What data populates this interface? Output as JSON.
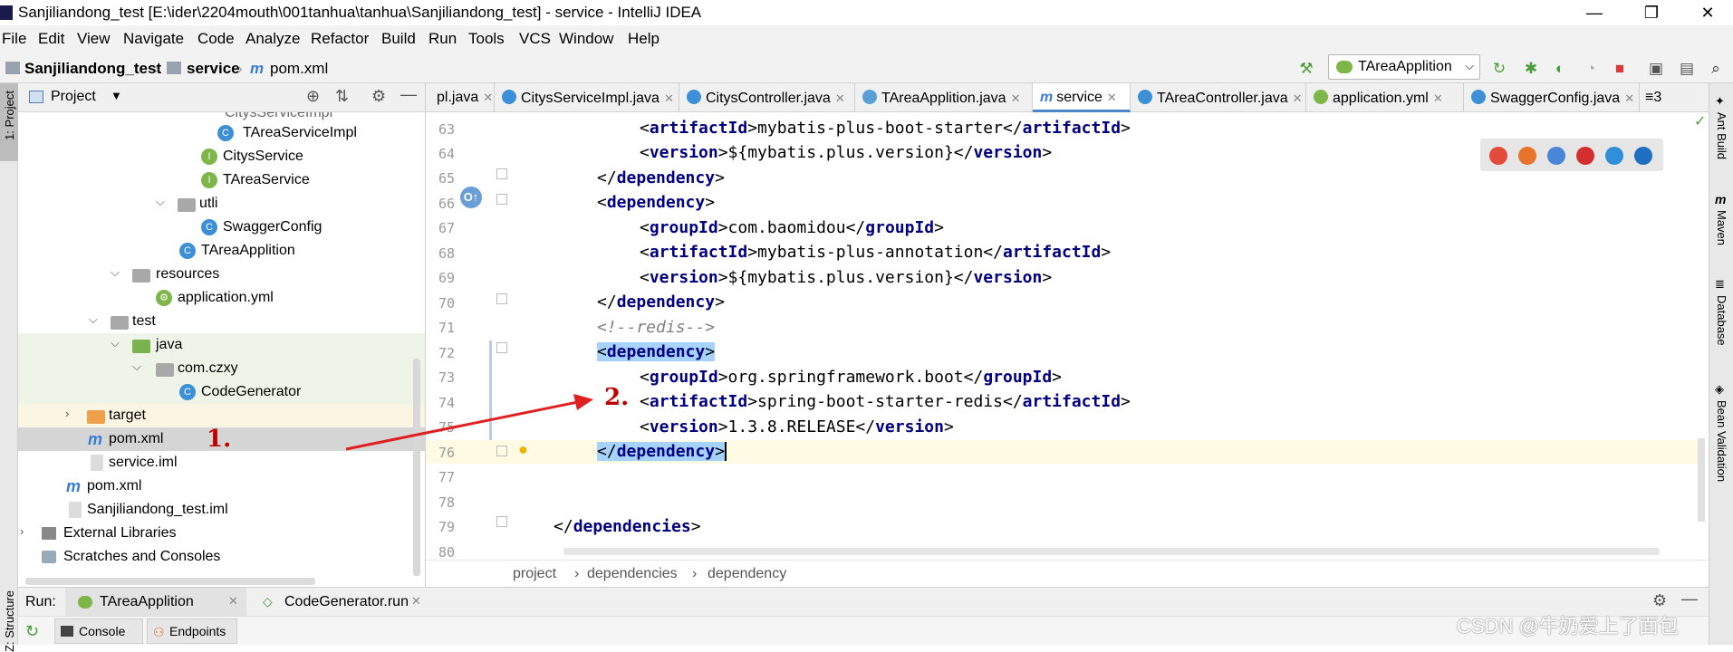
{
  "window": {
    "title": "Sanjiliandong_test [E:\\ider\\2204mouth\\001tanhua\\tanhua\\Sanjiliandong_test] - service - IntelliJ IDEA"
  },
  "menu": [
    "File",
    "Edit",
    "View",
    "Navigate",
    "Code",
    "Analyze",
    "Refactor",
    "Build",
    "Run",
    "Tools",
    "VCS",
    "Window",
    "Help"
  ],
  "breadcrumb_nav": [
    "Sanjiliandong_test",
    "service",
    "pom.xml"
  ],
  "run_config": {
    "label": "TAreaApplition"
  },
  "project_panel": {
    "header": "Project",
    "tree": [
      {
        "label": "TAreaServiceImpl",
        "icon": "class-icon"
      },
      {
        "label": "CitysService",
        "icon": "interface-icon"
      },
      {
        "label": "TAreaService",
        "icon": "interface-icon"
      },
      {
        "label": "utli",
        "icon": "folder-icon"
      },
      {
        "label": "SwaggerConfig",
        "icon": "class-icon"
      },
      {
        "label": "TAreaApplition",
        "icon": "spring-class-icon"
      },
      {
        "label": "resources",
        "icon": "folder-icon"
      },
      {
        "label": "application.yml",
        "icon": "yml-icon"
      },
      {
        "label": "test",
        "icon": "folder-icon"
      },
      {
        "label": "java",
        "icon": "folder-icon"
      },
      {
        "label": "com.czxy",
        "icon": "package-icon"
      },
      {
        "label": "CodeGenerator",
        "icon": "class-icon"
      },
      {
        "label": "target",
        "icon": "folder-icon"
      },
      {
        "label": "pom.xml",
        "icon": "maven-icon"
      },
      {
        "label": "service.iml",
        "icon": "iml-icon"
      },
      {
        "label": "pom.xml",
        "icon": "maven-icon"
      },
      {
        "label": "Sanjiliandong_test.iml",
        "icon": "iml-icon"
      },
      {
        "label": "External Libraries",
        "icon": "library-icon"
      },
      {
        "label": "Scratches and Consoles",
        "icon": "scratch-icon"
      }
    ]
  },
  "editor_tabs": [
    {
      "label": "pl.java"
    },
    {
      "label": "CitysServiceImpl.java"
    },
    {
      "label": "CitysController.java"
    },
    {
      "label": "TAreaApplition.java"
    },
    {
      "label": "service"
    },
    {
      "label": "TAreaController.java"
    },
    {
      "label": "application.yml"
    },
    {
      "label": "SwaggerConfig.java"
    }
  ],
  "editor_tabs_overflow": "≡3",
  "code": {
    "line_numbers": [
      "63",
      "64",
      "65",
      "66",
      "67",
      "68",
      "69",
      "70",
      "71",
      "72",
      "73",
      "74",
      "75",
      "76",
      "77",
      "78",
      "79",
      "80"
    ],
    "lines": {
      "l63": {
        "open": "<",
        "tag1": "artifactId",
        "mid": ">mybatis-plus-boot-starter</",
        "tag2": "artifactId",
        "close": ">"
      },
      "l64": {
        "open": "<",
        "tag1": "version",
        "mid": ">${mybatis.plus.version}</",
        "tag2": "version",
        "close": ">"
      },
      "l65": {
        "open": "</",
        "tag1": "dependency",
        "close": ">"
      },
      "l66": {
        "open": "<",
        "tag1": "dependency",
        "close": ">"
      },
      "l67": {
        "open": "<",
        "tag1": "groupId",
        "mid": ">com.baomidou</",
        "tag2": "groupId",
        "close": ">"
      },
      "l68": {
        "open": "<",
        "tag1": "artifactId",
        "mid": ">mybatis-plus-annotation</",
        "tag2": "artifactId",
        "close": ">"
      },
      "l69": {
        "open": "<",
        "tag1": "version",
        "mid": ">${mybatis.plus.version}</",
        "tag2": "version",
        "close": ">"
      },
      "l70": {
        "open": "</",
        "tag1": "dependency",
        "close": ">"
      },
      "l71": {
        "comment": "<!--redis-->"
      },
      "l72": {
        "open": "<",
        "tag1": "dependency",
        "close": ">"
      },
      "l73": {
        "open": "<",
        "tag1": "groupId",
        "mid": ">org.springframework.boot</",
        "tag2": "groupId",
        "close": ">"
      },
      "l74": {
        "open": "<",
        "tag1": "artifactId",
        "mid": ">spring-boot-starter-redis</",
        "tag2": "artifactId",
        "close": ">"
      },
      "l75": {
        "open": "<",
        "tag1": "version",
        "mid": ">1.3.8.RELEASE</",
        "tag2": "version",
        "close": ">"
      },
      "l76": {
        "open": "</",
        "tag1": "dependency",
        "close": ">"
      },
      "l79": {
        "open": "</",
        "tag1": "dependencies",
        "close": ">"
      }
    }
  },
  "editor_breadcrumbs": [
    "project",
    "dependencies",
    "dependency"
  ],
  "right_tools": [
    "Ant Build",
    "Maven",
    "Database",
    "Bean Validation"
  ],
  "left_tools": [
    "1: Project",
    "Z: Structure"
  ],
  "run_panel": {
    "label": "Run:",
    "tabs": [
      "TAreaApplition",
      "CodeGenerator.run"
    ],
    "subtabs": [
      "Console",
      "Endpoints"
    ]
  },
  "annotations": {
    "one": "1.",
    "two": "2."
  },
  "watermark": "CSDN @牛奶爱上了面包",
  "colors": {
    "tag": "#000080",
    "comment": "#808080",
    "selection": "#a6d2ff",
    "annotation": "#c00000"
  }
}
